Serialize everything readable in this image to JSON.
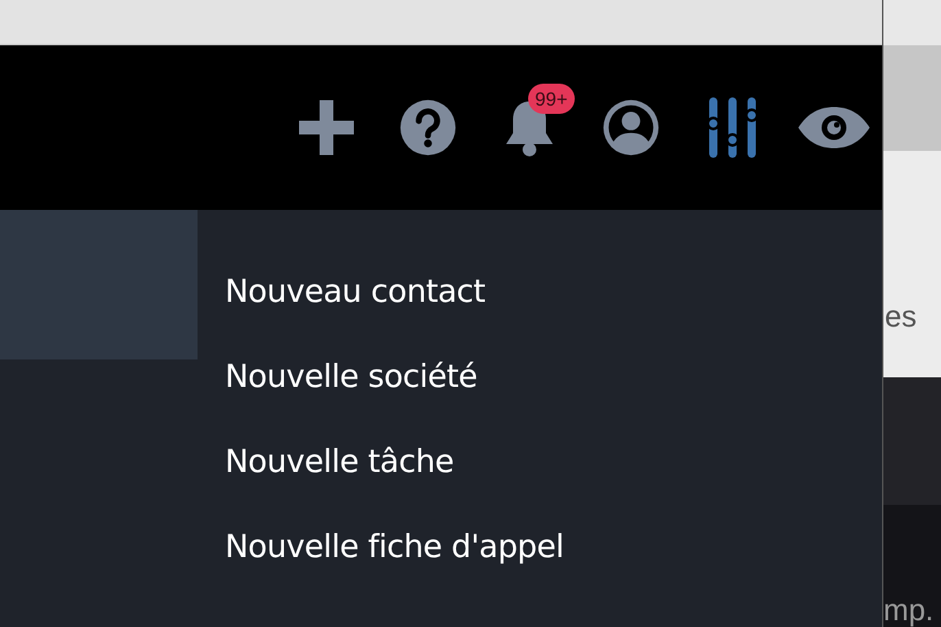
{
  "toolbar": {
    "icons": [
      {
        "kind": "plus",
        "active": false
      },
      {
        "kind": "help",
        "active": false
      },
      {
        "kind": "bell",
        "active": false,
        "badge": "99+"
      },
      {
        "kind": "user",
        "active": false
      },
      {
        "kind": "sliders",
        "active": true
      },
      {
        "kind": "eye",
        "active": false
      }
    ]
  },
  "menu": {
    "items": [
      "Nouveau contact",
      "Nouvelle société",
      "Nouvelle tâche",
      "Nouvelle fiche d'appel"
    ]
  },
  "background": {
    "text_1": "es",
    "text_2": "mp."
  }
}
